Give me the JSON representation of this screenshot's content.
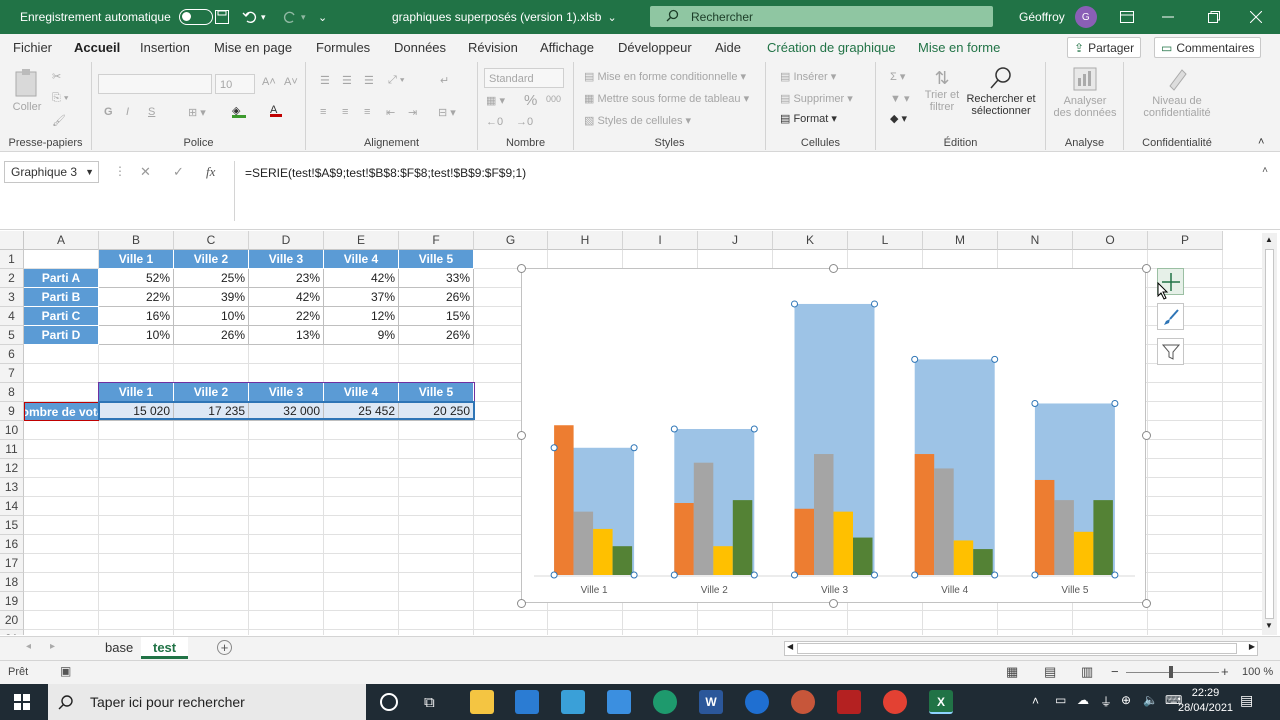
{
  "title_bar": {
    "autosave_label": "Enregistrement automatique",
    "file_name": "graphiques superposés (version 1).xlsb",
    "file_dropdown": "⌄",
    "search_placeholder": "Rechercher",
    "user_name": "Géoffroy",
    "user_initial": "G"
  },
  "menu": {
    "tabs": [
      "Fichier",
      "Accueil",
      "Insertion",
      "Mise en page",
      "Formules",
      "Données",
      "Révision",
      "Affichage",
      "Développeur",
      "Aide",
      "Création de graphique",
      "Mise en forme"
    ],
    "active_tab": "Accueil",
    "share_label": "Partager",
    "comments_label": "Commentaires"
  },
  "ribbon": {
    "clipboard": {
      "paste": "Coller",
      "label": "Presse-papiers"
    },
    "font": {
      "size": "10",
      "bold": "G",
      "italic": "I",
      "underline": "S",
      "label": "Police"
    },
    "alignment": {
      "label": "Alignement"
    },
    "number": {
      "format": "Standard",
      "percent": "%",
      "thousands": "000",
      "label": "Nombre"
    },
    "styles": {
      "conditional": "Mise en forme conditionnelle",
      "table": "Mettre sous forme de tableau",
      "cell_styles": "Styles de cellules",
      "label": "Styles"
    },
    "cells": {
      "insert": "Insérer",
      "delete": "Supprimer",
      "format": "Format",
      "label": "Cellules"
    },
    "editing": {
      "sort_l1": "Trier et",
      "sort_l2": "filtrer",
      "find_l1": "Rechercher et",
      "find_l2": "sélectionner",
      "label": "Édition"
    },
    "analysis": {
      "l1": "Analyser",
      "l2": "des données",
      "label": "Analyse"
    },
    "privacy": {
      "l1": "Niveau de",
      "l2": "confidentialité",
      "label": "Confidentialité"
    }
  },
  "formula_bar": {
    "name_box": "Graphique 3",
    "cancel": "✕",
    "enter": "✓",
    "fx": "fx",
    "formula": "=SERIE(test!$A$9;test!$B$8:$F$8;test!$B$9:$F$9;1)"
  },
  "grid": {
    "columns": [
      "A",
      "B",
      "C",
      "D",
      "E",
      "F",
      "G",
      "H",
      "I",
      "J",
      "K",
      "L",
      "M",
      "N",
      "O",
      "P"
    ],
    "rows": [
      "1",
      "2",
      "3",
      "4",
      "5",
      "6",
      "7",
      "8",
      "9",
      "10",
      "11",
      "12",
      "13",
      "14",
      "15",
      "16",
      "17",
      "18",
      "19",
      "20",
      "21"
    ],
    "table1": {
      "headers": [
        "Ville 1",
        "Ville 2",
        "Ville 3",
        "Ville 4",
        "Ville 5"
      ],
      "rows": [
        {
          "label": "Parti A",
          "values": [
            "52%",
            "25%",
            "23%",
            "42%",
            "33%"
          ]
        },
        {
          "label": "Parti B",
          "values": [
            "22%",
            "39%",
            "42%",
            "37%",
            "26%"
          ]
        },
        {
          "label": "Parti C",
          "values": [
            "16%",
            "10%",
            "22%",
            "12%",
            "15%"
          ]
        },
        {
          "label": "Parti D",
          "values": [
            "10%",
            "26%",
            "13%",
            "9%",
            "26%"
          ]
        }
      ]
    },
    "table2": {
      "headers": [
        "Ville 1",
        "Ville 2",
        "Ville 3",
        "Ville 4",
        "Ville 5"
      ],
      "label": "Nombre de votants",
      "values": [
        "15 020",
        "17 235",
        "32 000",
        "25 452",
        "20 250"
      ]
    }
  },
  "chart_data": {
    "type": "bar",
    "categories": [
      "Ville 1",
      "Ville 2",
      "Ville 3",
      "Ville 4",
      "Ville 5"
    ],
    "series": [
      {
        "values": [
          15020,
          17235,
          32000,
          25452,
          20250
        ],
        "color": "#9dc3e6"
      }
    ],
    "inner_series": [
      {
        "values": [
          0.52,
          0.25,
          0.23,
          0.42,
          0.33
        ],
        "color": "#ed7d31"
      },
      {
        "values": [
          0.22,
          0.39,
          0.42,
          0.37,
          0.26
        ],
        "color": "#a5a5a5"
      },
      {
        "values": [
          0.16,
          0.1,
          0.22,
          0.12,
          0.15
        ],
        "color": "#ffc000"
      },
      {
        "values": [
          0.1,
          0.26,
          0.13,
          0.09,
          0.26
        ],
        "color": "#548235"
      }
    ],
    "ylim": [
      0,
      34000
    ],
    "inner_ylim": [
      0,
      1
    ],
    "title": "",
    "legend": "none",
    "grid": false
  },
  "sheets": {
    "tabs": [
      "base",
      "test"
    ],
    "active": "test"
  },
  "status": {
    "ready": "Prêt",
    "zoom": "100 %"
  },
  "taskbar": {
    "search_placeholder": "Taper ici pour rechercher",
    "time": "22:29",
    "date": "28/04/2021"
  }
}
